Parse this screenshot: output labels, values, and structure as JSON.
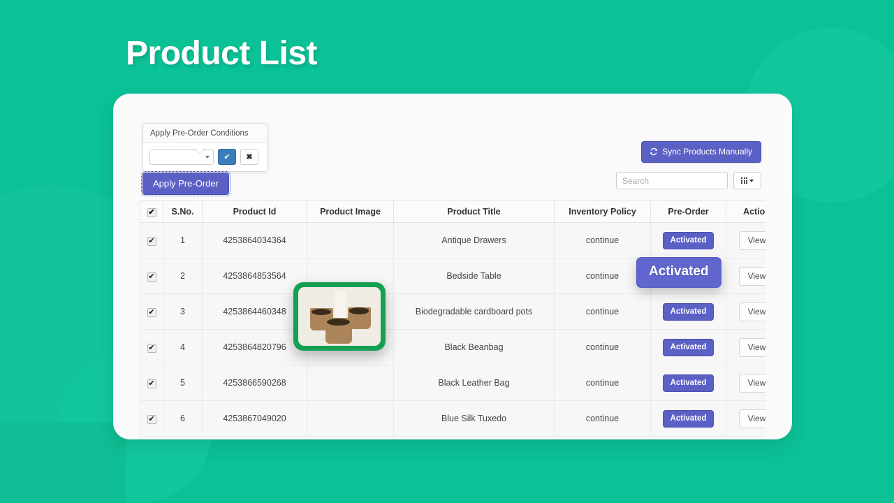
{
  "page": {
    "title": "Product List",
    "background_color": "#0bc196",
    "accent_color": "#5b60c4",
    "highlight_color": "#14a053"
  },
  "conditions_panel": {
    "title": "Apply Pre-Order Conditions",
    "select_value": "",
    "confirm_label": "✔",
    "cancel_label": "✖"
  },
  "apply_button": {
    "label": "Apply Pre-Order"
  },
  "sync_button": {
    "label": "Sync Products Manually",
    "icon": "sync-icon"
  },
  "search": {
    "placeholder": "Search",
    "value": "",
    "columns_icon": "grid-icon"
  },
  "table": {
    "headers": {
      "select_all": "✔",
      "sno": "S.No.",
      "product_id": "Product Id",
      "product_image": "Product Image",
      "product_title": "Product Title",
      "inventory_policy": "Inventory Policy",
      "pre_order": "Pre-Order",
      "action": "Action"
    },
    "rows": [
      {
        "checked": true,
        "sno": "1",
        "product_id": "4253864034364",
        "image": "nursery-room-thumbnail",
        "title": "Antique Drawers",
        "inventory_policy": "continue",
        "pre_order": "Activated",
        "action": "View"
      },
      {
        "checked": true,
        "sno": "2",
        "product_id": "4253864853564",
        "image": "dark-board-thumbnail",
        "title": "Bedside Table",
        "inventory_policy": "continue",
        "pre_order": "Activated",
        "action": "View"
      },
      {
        "checked": true,
        "sno": "3",
        "product_id": "4253864460348",
        "image": "cardboard-pots-thumbnail",
        "title": "Biodegradable cardboard pots",
        "inventory_policy": "continue",
        "pre_order": "Activated",
        "action": "View"
      },
      {
        "checked": true,
        "sno": "4",
        "product_id": "4253864820796",
        "image": "black-beanbag-thumbnail",
        "title": "Black Beanbag",
        "inventory_policy": "continue",
        "pre_order": "Activated",
        "action": "View"
      },
      {
        "checked": true,
        "sno": "5",
        "product_id": "4253866590268",
        "image": "leather-bag-thumbnail",
        "title": "Black Leather Bag",
        "inventory_policy": "continue",
        "pre_order": "Activated",
        "action": "View"
      },
      {
        "checked": true,
        "sno": "6",
        "product_id": "4253867049020",
        "image": "blue-tuxedo-thumbnail",
        "title": "Blue Silk Tuxedo",
        "inventory_policy": "continue",
        "pre_order": "Activated",
        "action": "View"
      }
    ]
  },
  "overlays": {
    "hovered_badge_label": "Activated",
    "zoomed_image_row": "3"
  }
}
